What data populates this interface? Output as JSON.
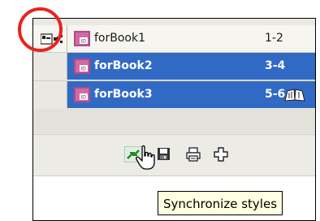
{
  "books": [
    {
      "name": "forBook1",
      "pages": "1-2",
      "selected": false,
      "style_source": true
    },
    {
      "name": "forBook2",
      "pages": "3-4",
      "selected": true,
      "style_source": false
    },
    {
      "name": "forBook3",
      "pages": "5-6",
      "selected": true,
      "style_source": false,
      "open": true
    }
  ],
  "toolbar": {
    "icons": [
      "synchronize-styles-icon",
      "save-book-icon",
      "print-book-icon",
      "add-document-icon"
    ]
  },
  "tooltip": {
    "text": "Synchronize styles"
  },
  "colors": {
    "selection": "#316ac5",
    "annotation_circle": "#e8231f",
    "tooltip_bg": "#ffffe1"
  }
}
